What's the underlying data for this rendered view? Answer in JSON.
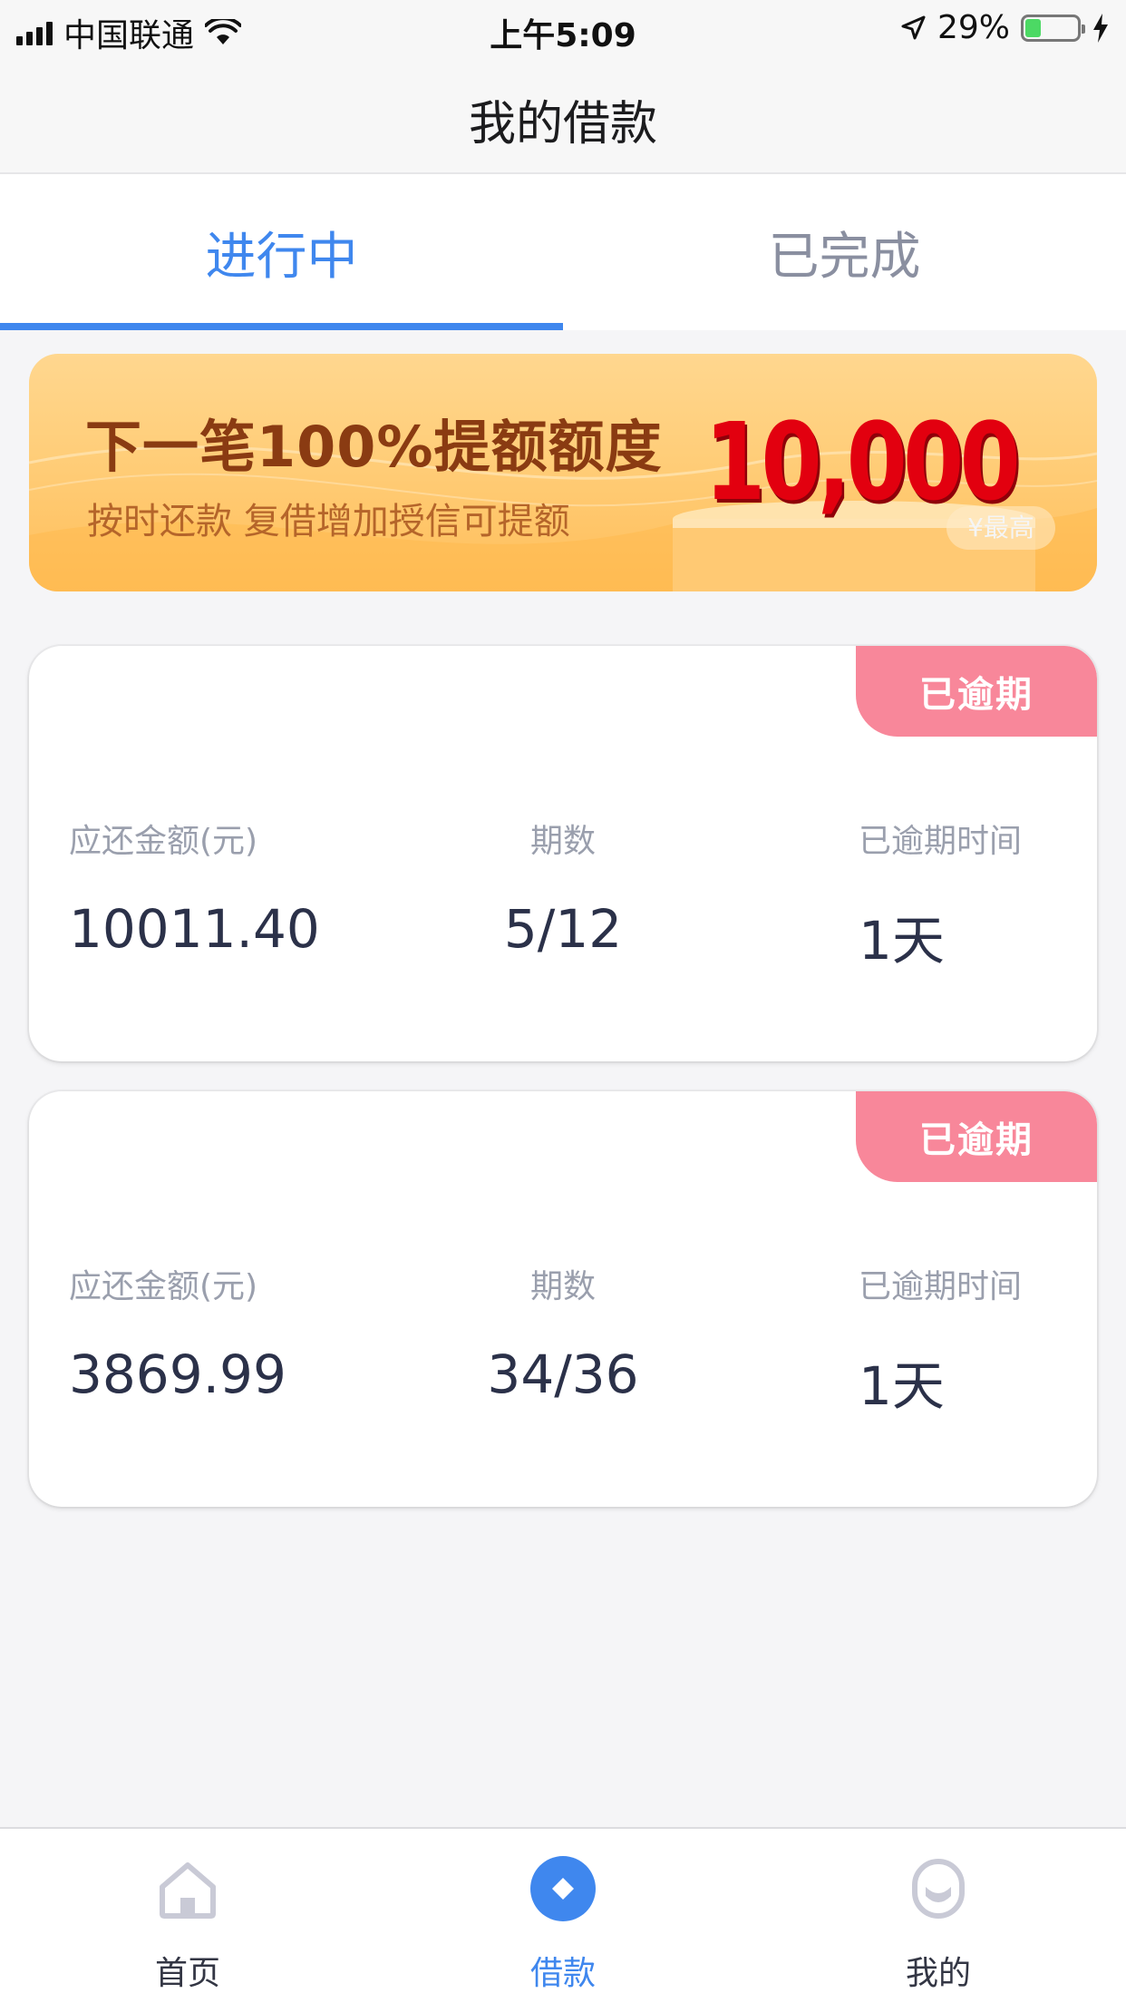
{
  "status_bar": {
    "carrier": "中国联通",
    "time": "上午5:09",
    "battery": "29%",
    "battery_level": 0.29
  },
  "nav": {
    "title": "我的借款"
  },
  "tabs": [
    {
      "label": "进行中",
      "active": true
    },
    {
      "label": "已完成",
      "active": false
    }
  ],
  "banner": {
    "title": "下一笔100%提额额度",
    "subtitle": "按时还款  复借增加授信可提额",
    "amount": "10,000",
    "hint": "¥最高"
  },
  "loans": [
    {
      "badge": "已逾期",
      "amount_label": "应还金额(元)",
      "amount": "10011.40",
      "period_label": "期数",
      "period": "5/12",
      "overdue_label": "已逾期时间",
      "overdue": "1天"
    },
    {
      "badge": "已逾期",
      "amount_label": "应还金额(元)",
      "amount": "3869.99",
      "period_label": "期数",
      "period": "34/36",
      "overdue_label": "已逾期时间",
      "overdue": "1天"
    }
  ],
  "tabbar": [
    {
      "label": "首页",
      "icon": "home-icon",
      "active": false
    },
    {
      "label": "借款",
      "icon": "loan-icon",
      "active": true
    },
    {
      "label": "我的",
      "icon": "profile-icon",
      "active": false
    }
  ],
  "colors": {
    "accent": "#3f87ee",
    "overdue_badge": "#f8879a",
    "banner_amount": "#e2000f"
  }
}
